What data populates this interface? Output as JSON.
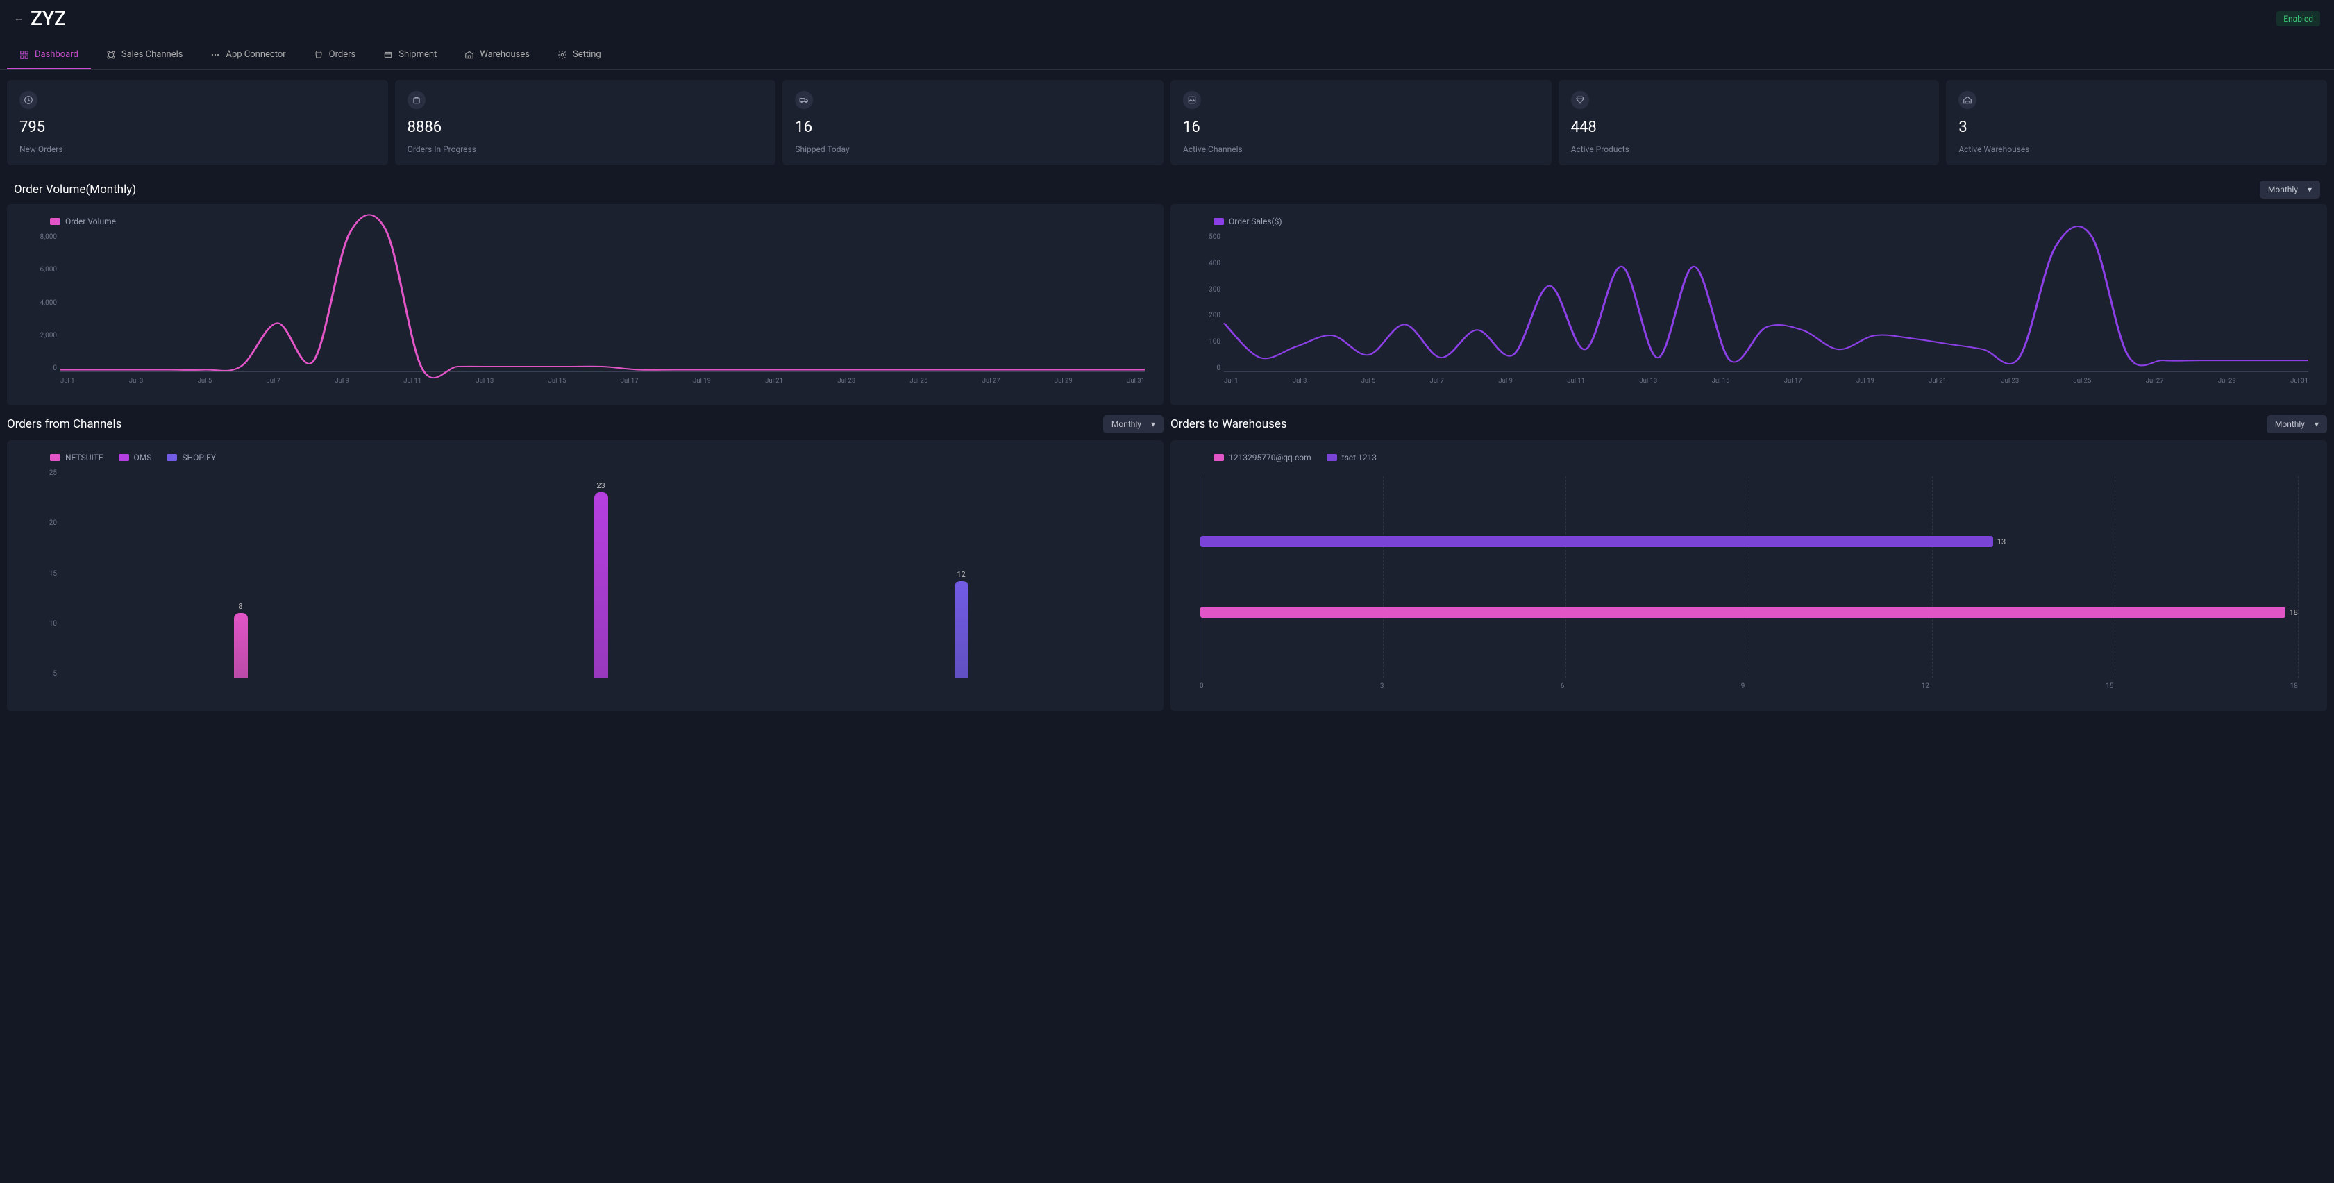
{
  "header": {
    "title": "ZYZ",
    "enabled_label": "Enabled"
  },
  "tabs": [
    {
      "label": "Dashboard",
      "icon": "dashboard-icon",
      "active": true
    },
    {
      "label": "Sales Channels",
      "icon": "channels-icon",
      "active": false
    },
    {
      "label": "App Connector",
      "icon": "connector-icon",
      "active": false
    },
    {
      "label": "Orders",
      "icon": "cart-icon",
      "active": false
    },
    {
      "label": "Shipment",
      "icon": "shipment-icon",
      "active": false
    },
    {
      "label": "Warehouses",
      "icon": "warehouse-icon",
      "active": false
    },
    {
      "label": "Setting",
      "icon": "gear-icon",
      "active": false
    }
  ],
  "metrics": [
    {
      "value": "795",
      "label": "New Orders",
      "icon": "new-orders-icon"
    },
    {
      "value": "8886",
      "label": "Orders In Progress",
      "icon": "progress-icon"
    },
    {
      "value": "16",
      "label": "Shipped Today",
      "icon": "truck-icon"
    },
    {
      "value": "16",
      "label": "Active Channels",
      "icon": "image-icon"
    },
    {
      "value": "448",
      "label": "Active Products",
      "icon": "diamond-icon"
    },
    {
      "value": "3",
      "label": "Active Warehouses",
      "icon": "house-icon"
    }
  ],
  "order_volume": {
    "title": "Order Volume(Monthly)",
    "dropdown": "Monthly",
    "legend_volume": "Order Volume",
    "legend_sales": "Order Sales($)"
  },
  "channels_section": {
    "title": "Orders from Channels",
    "dropdown": "Monthly",
    "legend": [
      "NETSUITE",
      "OMS",
      "SHOPIFY"
    ]
  },
  "warehouses_section": {
    "title": "Orders to Warehouses",
    "dropdown": "Monthly",
    "legend": [
      "1213295770@qq.com",
      "tset 1213"
    ]
  },
  "chart_data": [
    {
      "type": "line",
      "title": "Order Volume",
      "xlabel": "",
      "ylabel": "",
      "ylim": [
        0,
        8000
      ],
      "categories": [
        "Jul 1",
        "Jul 3",
        "Jul 5",
        "Jul 7",
        "Jul 9",
        "Jul 11",
        "Jul 13",
        "Jul 15",
        "Jul 17",
        "Jul 19",
        "Jul 21",
        "Jul 23",
        "Jul 25",
        "Jul 27",
        "Jul 29",
        "Jul 31"
      ],
      "series": [
        {
          "name": "Order Volume",
          "color": "#e255c7",
          "values": [
            100,
            100,
            100,
            100,
            100,
            300,
            2800,
            600,
            8000,
            8200,
            200,
            280,
            280,
            280,
            280,
            280,
            100,
            100,
            100,
            100,
            100,
            100,
            100,
            100,
            100,
            100,
            100,
            100,
            100,
            100,
            100
          ]
        }
      ],
      "y_ticks": [
        "8,000",
        "6,000",
        "4,000",
        "2,000",
        "0"
      ]
    },
    {
      "type": "line",
      "title": "Order Sales($)",
      "xlabel": "",
      "ylabel": "",
      "ylim": [
        0,
        500
      ],
      "categories": [
        "Jul 1",
        "Jul 3",
        "Jul 5",
        "Jul 7",
        "Jul 9",
        "Jul 11",
        "Jul 13",
        "Jul 15",
        "Jul 17",
        "Jul 19",
        "Jul 21",
        "Jul 23",
        "Jul 25",
        "Jul 27",
        "Jul 29",
        "Jul 31"
      ],
      "series": [
        {
          "name": "Order Sales($)",
          "color": "#8b3fe5",
          "values": [
            175,
            50,
            90,
            130,
            60,
            170,
            50,
            150,
            60,
            310,
            80,
            380,
            50,
            380,
            40,
            160,
            150,
            80,
            130,
            120,
            100,
            80,
            50,
            450,
            490,
            60,
            40,
            40,
            40,
            40,
            40
          ]
        }
      ],
      "y_ticks": [
        "500",
        "400",
        "300",
        "200",
        "100",
        "0"
      ]
    },
    {
      "type": "bar",
      "title": "Orders from Channels",
      "xlabel": "",
      "ylabel": "",
      "ylim": [
        0,
        25
      ],
      "categories": [
        "NETSUITE",
        "OMS",
        "SHOPIFY"
      ],
      "values": [
        8,
        23,
        12
      ],
      "colors": [
        "#e255c7",
        "#b63fe0",
        "#725ce5"
      ],
      "y_ticks": [
        "25",
        "20",
        "15",
        "10",
        "5"
      ]
    },
    {
      "type": "bar",
      "orientation": "horizontal",
      "title": "Orders to Warehouses",
      "xlabel": "",
      "ylabel": "",
      "xlim": [
        0,
        18
      ],
      "categories": [
        "tset 1213",
        "1213295770@qq.com"
      ],
      "values": [
        13,
        18
      ],
      "colors": [
        "#7a44d6",
        "#e255c7"
      ],
      "x_ticks": [
        "0",
        "3",
        "6",
        "9",
        "12",
        "15",
        "18"
      ]
    }
  ]
}
